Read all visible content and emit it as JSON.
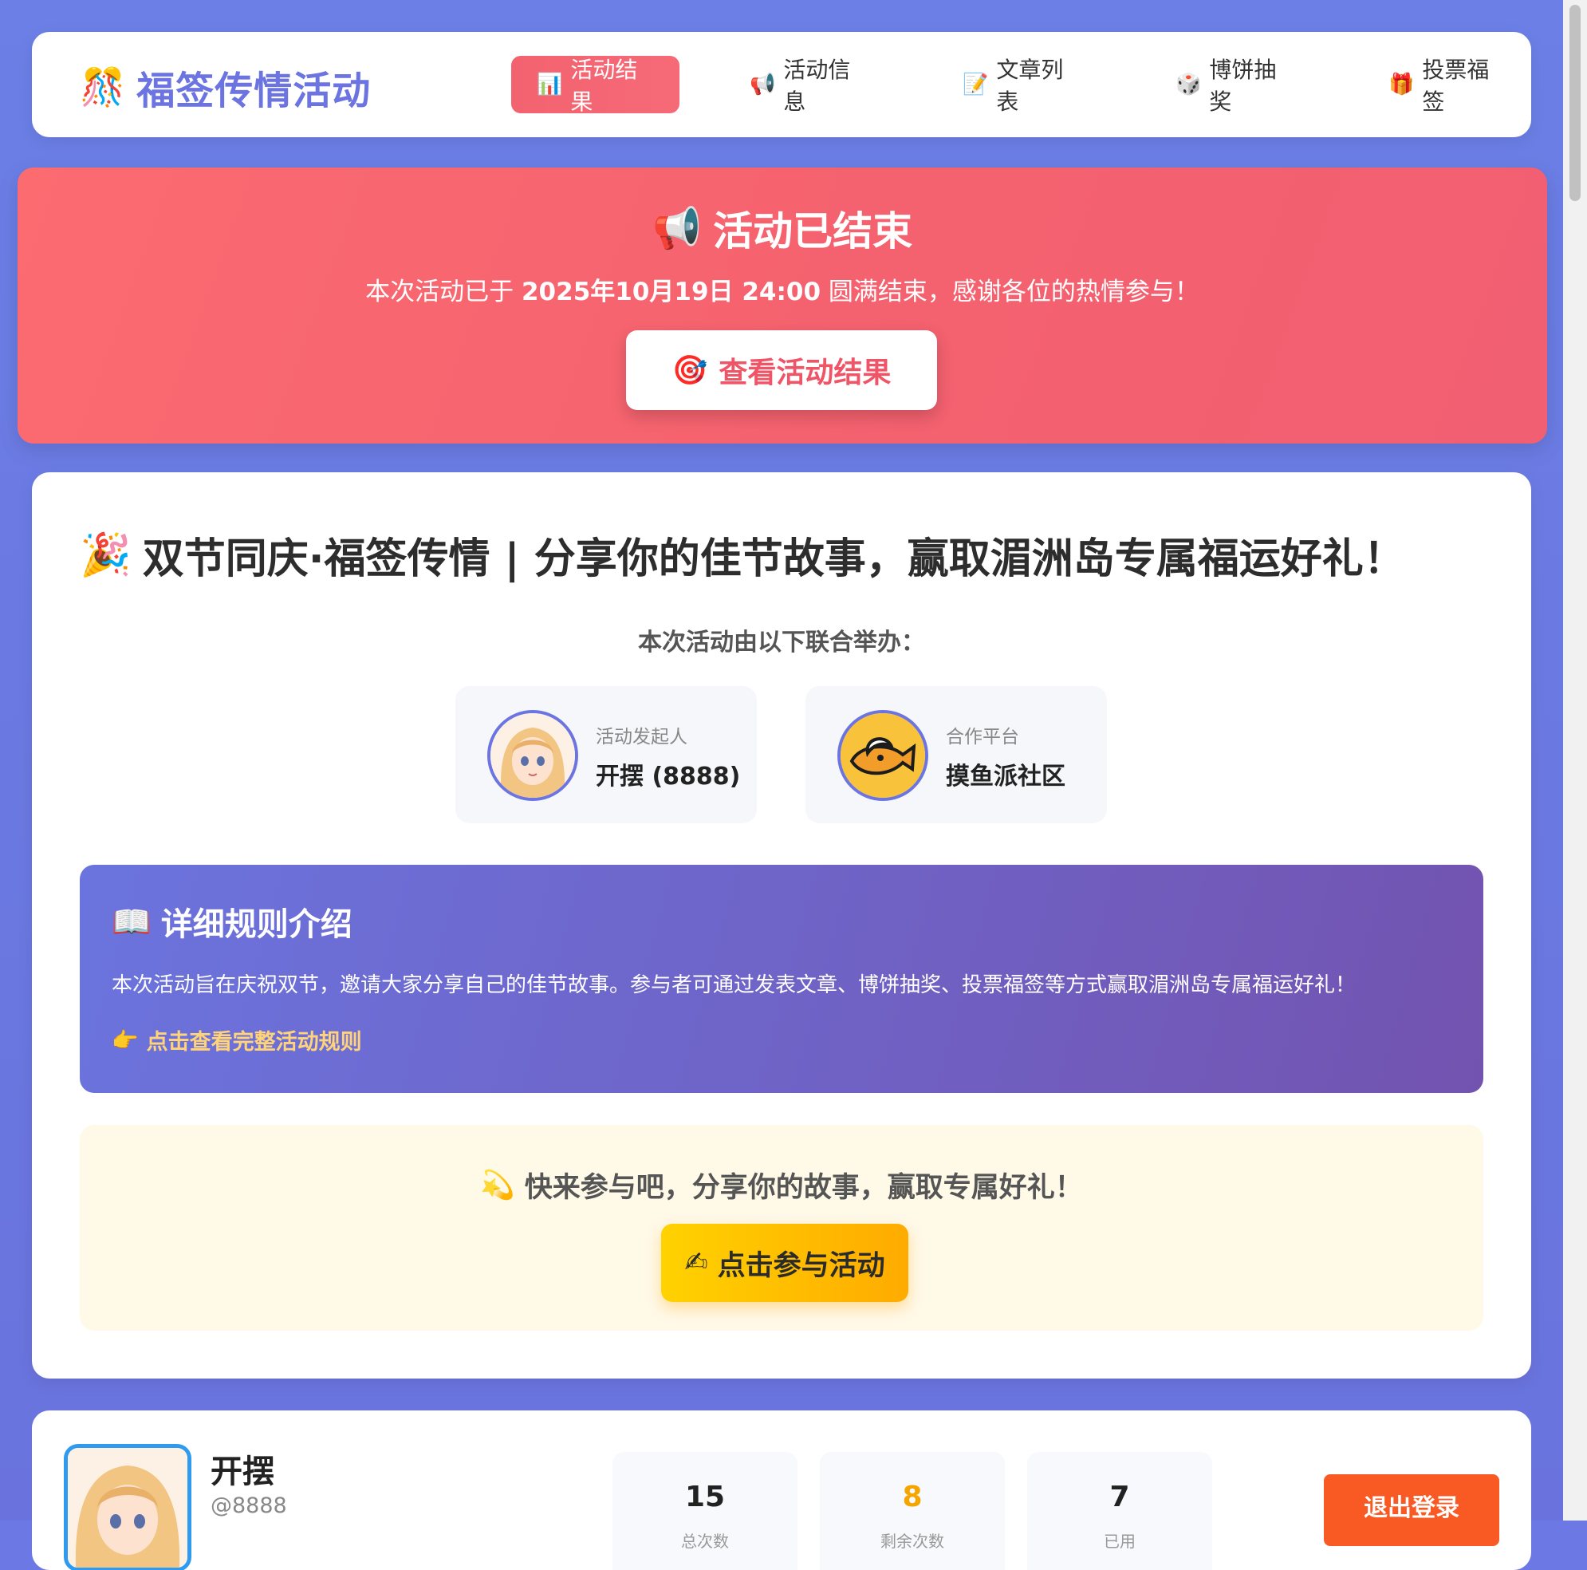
{
  "nav": {
    "brand_icon": "🎊",
    "brand_title": "福签传情活动",
    "tabs": [
      {
        "icon": "📊",
        "label": "活动结果",
        "active": true
      },
      {
        "icon": "📢",
        "label": "活动信息"
      },
      {
        "icon": "📝",
        "label": "文章列表"
      },
      {
        "icon": "🎲",
        "label": "博饼抽奖"
      },
      {
        "icon": "🎁",
        "label": "投票福签"
      }
    ]
  },
  "banner": {
    "icon": "📢",
    "title": "活动已结束",
    "text_before": "本次活动已于 ",
    "date": "2025年10月19日 24:00",
    "text_after": " 圆满结束，感谢各位的热情参与！",
    "button_icon": "🎯",
    "button_label": "查看活动结果"
  },
  "main": {
    "title_icon": "🎉",
    "title": "双节同庆·福签传情 | 分享你的佳节故事，赢取湄洲岛专属福运好礼！",
    "organizer_caption": "本次活动由以下联合举办：",
    "organizers": [
      {
        "role": "活动发起人",
        "name": "开摆 (8888)"
      },
      {
        "role": "合作平台",
        "name": "摸鱼派社区"
      }
    ],
    "rules": {
      "icon": "📖",
      "title": "详细规则介绍",
      "text": "本次活动旨在庆祝双节，邀请大家分享自己的佳节故事。参与者可通过发表文章、博饼抽奖、投票福签等方式赢取湄洲岛专属福运好礼！",
      "link_icon": "👉",
      "link": "点击查看完整活动规则"
    },
    "cta": {
      "icon": "💫",
      "text": "快来参与吧，分享你的故事，赢取专属好礼！",
      "button_icon": "✍",
      "button": "点击参与活动"
    }
  },
  "user": {
    "name": "开摆",
    "handle": "@8888",
    "stats": [
      {
        "value": "15",
        "label": "总次数"
      },
      {
        "value": "8",
        "label": "剩余次数"
      },
      {
        "value": "7",
        "label": "已用"
      }
    ],
    "logout": "退出登录"
  },
  "colors": {
    "primary": "#6b74e0",
    "banner": "#f4616f",
    "gold": "#ffb800",
    "logout": "#f95a24"
  }
}
